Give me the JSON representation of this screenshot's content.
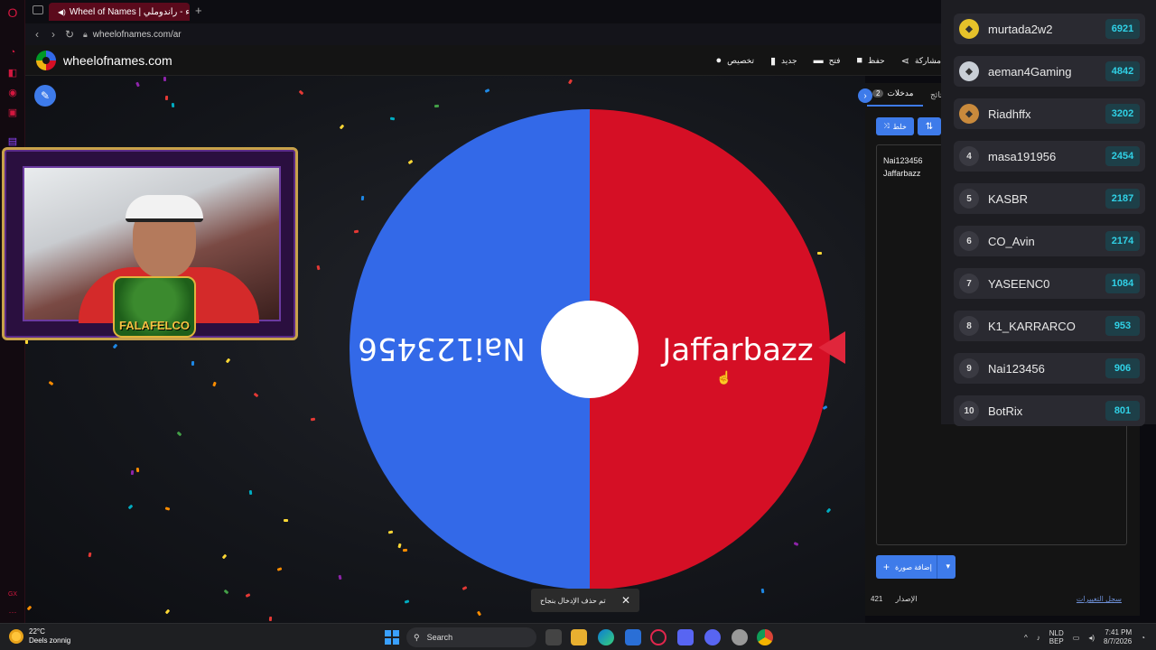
{
  "browser": {
    "tab_title": "Wheel of Names | عجلة الأسماء - راندوملي",
    "url": "wheelofnames.com/ar",
    "new_tab": "+"
  },
  "site": {
    "name": "wheelofnames.com",
    "menu": [
      {
        "label": "تخصيص",
        "icon": "palette-icon"
      },
      {
        "label": "جديد",
        "icon": "file-icon"
      },
      {
        "label": "فتح",
        "icon": "folder-icon"
      },
      {
        "label": "حفظ",
        "icon": "save-icon"
      },
      {
        "label": "مشاركة",
        "icon": "share-icon"
      }
    ]
  },
  "wheel": {
    "segments": [
      {
        "label": "Jaffarbazz",
        "color": "#d50f25"
      },
      {
        "label": "Nai123456",
        "color": "#3369e8"
      }
    ],
    "pointer_color": "#e0263b"
  },
  "panel": {
    "tab_entries": "مدخلات",
    "entries_count": "2",
    "tab_results": "النتائج",
    "shuffle_label": "خلط",
    "sort_label": "فرز",
    "entries": [
      "Nai123456",
      "Jaffarbazz"
    ],
    "add_image_label": "إضافة صورة",
    "version_label": "الإصدار",
    "version_number": "421",
    "changelog_label": "سجل التغييرات"
  },
  "toast": {
    "message": "تم حذف الإدخال بنجاح",
    "close": "✕"
  },
  "webcam": {
    "badge_text": "FALAFELCO"
  },
  "leaderboard": [
    {
      "rank": "1",
      "name": "murtada2w2",
      "score": "6921"
    },
    {
      "rank": "2",
      "name": "aeman4Gaming",
      "score": "4842"
    },
    {
      "rank": "3",
      "name": "Riadhffx",
      "score": "3202"
    },
    {
      "rank": "4",
      "name": "masa191956",
      "score": "2454"
    },
    {
      "rank": "5",
      "name": "KASBR",
      "score": "2187"
    },
    {
      "rank": "6",
      "name": "CO_Avin",
      "score": "2174"
    },
    {
      "rank": "7",
      "name": "YASEENC0",
      "score": "1084"
    },
    {
      "rank": "8",
      "name": "K1_KARRARCO",
      "score": "953"
    },
    {
      "rank": "9",
      "name": "Nai123456",
      "score": "906"
    },
    {
      "rank": "10",
      "name": "BotRix",
      "score": "801"
    }
  ],
  "taskbar": {
    "temperature": "22°C",
    "weather": "Deels zonnig",
    "search_placeholder": "Search",
    "lang_top": "NLD",
    "lang_bottom": "BEP",
    "time": "7:41 PM",
    "date": "8/7/2026"
  }
}
